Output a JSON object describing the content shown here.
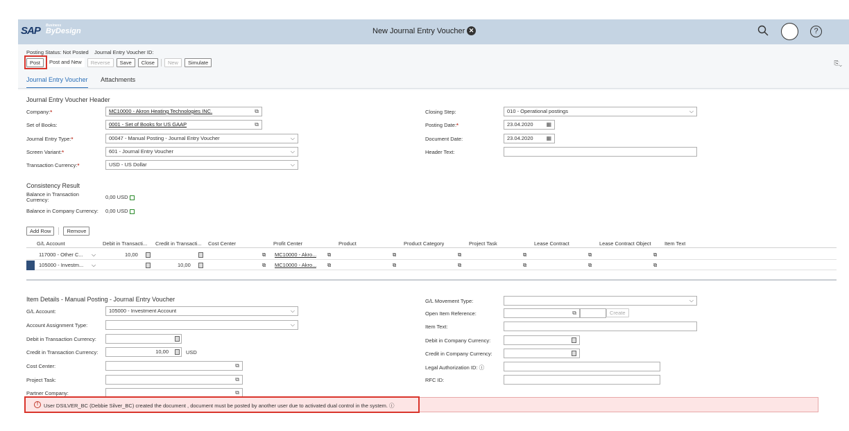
{
  "shell": {
    "logo_sap": "SAP",
    "logo_business": "Business",
    "logo_bydesign": "ByDesign",
    "title": "New Journal Entry Voucher"
  },
  "header": {
    "posting_status": "Posting Status: Not Posted",
    "voucher_id": "Journal Entry Voucher ID:"
  },
  "toolbar": {
    "post": "Post",
    "post_and_new": "Post and New",
    "reverse": "Reverse",
    "save": "Save",
    "close": "Close",
    "new": "New",
    "simulate": "Simulate"
  },
  "tabs": [
    "Journal Entry Voucher",
    "Attachments"
  ],
  "voucher_header": {
    "title": "Journal Entry Voucher Header",
    "company_label": "Company:",
    "company_value": "MC10000 - Akron Heating Technologies INC.",
    "set_of_books_label": "Set of Books:",
    "set_of_books_value": "0001 - Set of Books for US GAAP",
    "je_type_label": "Journal Entry Type:",
    "je_type_value": "00047 - Manual Posting - Journal Entry Voucher",
    "screen_variant_label": "Screen Variant:",
    "screen_variant_value": "601 - Journal Entry Voucher",
    "txn_currency_label": "Transaction Currency:",
    "txn_currency_value": "USD - US Dollar",
    "closing_step_label": "Closing Step:",
    "closing_step_value": "010 - Operational postings",
    "posting_date_label": "Posting Date:",
    "posting_date_value": "23.04.2020",
    "document_date_label": "Document Date:",
    "document_date_value": "23.04.2020",
    "header_text_label": "Header Text:",
    "header_text_value": ""
  },
  "consistency": {
    "title": "Consistency Result",
    "balance_txn_label": "Balance in Transaction Currency:",
    "balance_txn_value": "0,00 USD",
    "balance_company_label": "Balance in Company Currency:",
    "balance_company_value": "0,00 USD"
  },
  "grid": {
    "add_row": "Add Row",
    "remove": "Remove",
    "columns": [
      "G/L Account",
      "Debit in Transacti...",
      "Credit in Transacti...",
      "Cost Center",
      "Profit Center",
      "Product",
      "Product Category",
      "Project Task",
      "Lease Contract",
      "Lease Contract Object",
      "Item Text"
    ],
    "rows": [
      {
        "gl": "117000 - Other C...",
        "debit": "10,00",
        "credit": "",
        "profit": "MC10000 - Akro..."
      },
      {
        "gl": "105000 - Investm...",
        "debit": "",
        "credit": "10,00",
        "profit": "MC10000 - Akro..."
      }
    ]
  },
  "item_details": {
    "title": "Item Details - Manual Posting - Journal Entry Voucher",
    "gl_account_label": "G/L Account:",
    "gl_account_value": "105000 - Investment Account",
    "account_assignment_label": "Account Assignment Type:",
    "debit_txn_label": "Debit in Transaction Currency:",
    "credit_txn_label": "Credit in Transaction Currency:",
    "credit_txn_value": "10,00",
    "credit_txn_currency": "USD",
    "cost_center_label": "Cost Center:",
    "project_task_label": "Project Task:",
    "partner_company_label": "Partner Company:",
    "gl_movement_label": "G/L Movement Type:",
    "open_item_label": "Open Item Reference:",
    "create_button": "Create",
    "item_text_label": "Item Text:",
    "debit_company_label": "Debit in Company Currency:",
    "credit_company_label": "Credit in Company Currency:",
    "legal_auth_label": "Legal Authorization ID:",
    "rfc_label": "RFC ID:"
  },
  "error": {
    "message": "User DSILVER_BC (Debbie Silver_BC) created the document , document must be posted by another user due to activated dual control in the system."
  },
  "colors": {
    "shell_bg": "#c5d4e3",
    "highlight": "#d9342b",
    "error_bg": "#fde5e5",
    "tab_active": "#2a6fb8"
  }
}
